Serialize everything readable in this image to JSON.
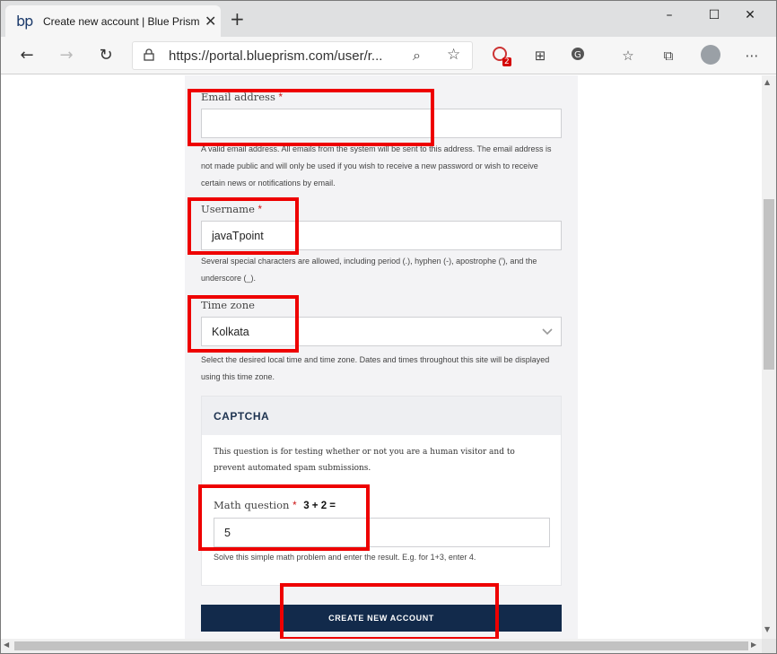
{
  "browser": {
    "tab": {
      "favicon": "bp",
      "title": "Create new account | Blue Prism"
    },
    "url": "https://portal.blueprism.com/user/r...",
    "extension_badge": "2",
    "icons": {
      "back": "arrow-left-icon",
      "forward": "arrow-right-icon",
      "refresh": "refresh-icon",
      "lock": "lock-icon",
      "zoom": "magnifier-icon",
      "favorite": "star-icon",
      "favorites_list": "favorites-icon",
      "collections": "collections-icon",
      "menu": "ellipsis-icon"
    }
  },
  "form": {
    "email": {
      "label": "Email address",
      "required_mark": "*",
      "value": "",
      "help": "A valid email address. All emails from the system will be sent to this address. The email address is not made public and will only be used if you wish to receive a new password or wish to receive certain news or notifications by email."
    },
    "username": {
      "label": "Username",
      "required_mark": "*",
      "value": "javaTpoint",
      "help": "Several special characters are allowed, including period (.), hyphen (-), apostrophe ('), and the underscore (_)."
    },
    "timezone": {
      "label": "Time zone",
      "selected": "Kolkata",
      "help": "Select the desired local time and time zone. Dates and times throughout this site will be displayed using this time zone."
    },
    "captcha": {
      "title": "CAPTCHA",
      "description": "This question is for testing whether or not you are a human visitor and to prevent automated spam submissions.",
      "question_label": "Math question",
      "required_mark": "*",
      "question": "3 + 2 =",
      "answer": "5",
      "help": "Solve this simple math problem and enter the result. E.g. for 1+3, enter 4."
    },
    "submit_label": "CREATE NEW ACCOUNT"
  },
  "colors": {
    "highlight": "#ee0000",
    "button": "#122a4b",
    "panel": "#f3f3f5"
  }
}
